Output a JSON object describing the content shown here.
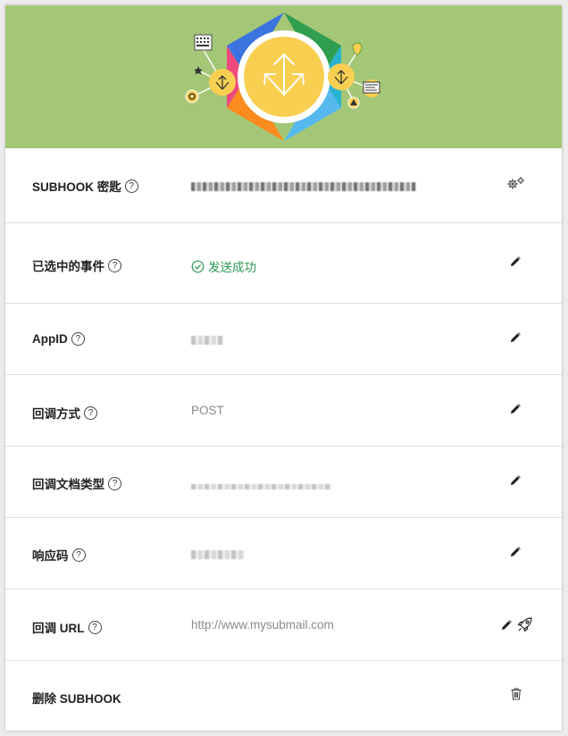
{
  "banner": {
    "icon": "subhook-hexagon-logo"
  },
  "rows": {
    "key": {
      "label": "SUBHOOK 密匙",
      "help": "?",
      "action_icon": "gears-icon"
    },
    "events": {
      "label": "已选中的事件",
      "help": "?",
      "value": "发送成功",
      "action_icon": "pencil-icon"
    },
    "appid": {
      "label": "AppID",
      "help": "?",
      "action_icon": "pencil-icon"
    },
    "method": {
      "label": "回调方式",
      "help": "?",
      "value": "POST",
      "action_icon": "pencil-icon"
    },
    "doctype": {
      "label": "回调文档类型",
      "help": "?",
      "action_icon": "pencil-icon"
    },
    "response": {
      "label": "响应码",
      "help": "?",
      "action_icon": "pencil-icon"
    },
    "url": {
      "label": "回调 URL",
      "help": "?",
      "value": "http://www.mysubmail.com",
      "action_icons": [
        "pencil-icon",
        "rocket-icon"
      ]
    },
    "delete": {
      "label": "删除 SUBHOOK",
      "action_icon": "trash-icon"
    }
  },
  "colors": {
    "banner": "#a4c777",
    "success": "#2e9a52",
    "muted": "#8a8a8a",
    "hub": "#f9cf51"
  }
}
